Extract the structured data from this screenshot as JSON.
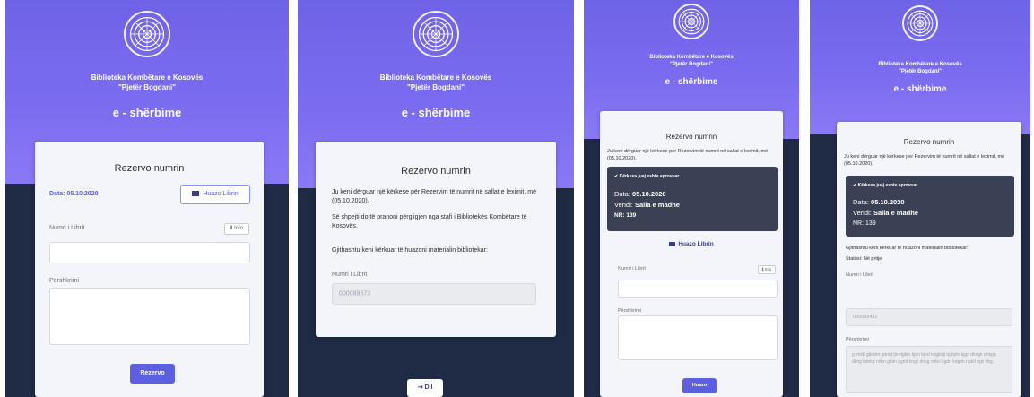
{
  "org": {
    "line1": "Biblioteka Kombëtare e Kosovës",
    "line2": "\"Pjetër Bogdani\"",
    "service": "e - shërbime"
  },
  "screens": [
    {
      "title": "Rezervo numrin",
      "date_label": "Data: 05.10.2020",
      "borrow_button": "Huazo Librin",
      "book_number_label": "Numri i Librit",
      "info_button": "Info",
      "description_label": "Përshkrimi",
      "submit_button": "Rezervo"
    },
    {
      "title": "Rezervo numrin",
      "message_1": "Ju keni dërguar një kërkese për Rezervim të numrit në sallat e leximit, më (05.10.2020).",
      "message_2": "Së shpejti do të pranoni përgjigjen nga stafi i Bibliotekës Kombëtare të Kosovës.",
      "message_3": "Gjithashtu keni kërkuar të huazoni materialin bibliotekar:",
      "book_number_label": "Numri i Librit",
      "book_number_value": "000089573",
      "exit_button": "Dil"
    },
    {
      "title": "Rezervo numrin",
      "message_1": "Ju keni dërguar një kërkese per Rezervim të numrit në sallat e leximit, më (05.10.2020).",
      "alert_heading": "Kërkesa juaj eshte aprovuar.",
      "alert_date_label": "Data:",
      "alert_date_value": "05.10.2020",
      "alert_place_label": "Vendi:",
      "alert_place_value": "Salla e madhe",
      "alert_nr": "NR: 139",
      "borrow_button": "Huazo Librin",
      "book_number_label": "Numri i Librit",
      "info_button": "Info",
      "description_label": "Përshkrimi",
      "submit_button": "Huazo"
    },
    {
      "title": "Rezervo numrin",
      "message_1": "Ju keni dërguar një kërkese per Rezervim të numrit në sallat e leximit, më (05.10.2020).",
      "alert_heading": "Kërkesa juaj eshte aprovuar.",
      "alert_date_label": "Data:",
      "alert_date_value": "05.10.2020",
      "alert_place_label": "Vendi:",
      "alert_place_value": "Salla e madhe",
      "alert_nr": "NR: 139",
      "message_2": "Gjithashtu keni kërkuar të huazoni materialin bibliotekar:",
      "status_text": "Statusi: Në pritje",
      "book_number_label": "Numri i Librit",
      "book_number_value": "000089432",
      "description_label": "Përshkrimi",
      "description_value": "g jmidl gbndm gdmd jbndgbjn kjdn bjnd knjgbdj ngbjdn kjgn dkngk dnkgn dkng kdnkg ndkn gkdn kgnd kngk dnkg ndkn kgdn kdgnk ngkd ngk dkg"
    }
  ],
  "colors": {
    "primary": "#5b5fe0",
    "header_gradient": "#6e63e6",
    "dark_bg": "#1f2a44",
    "alert_bg": "#3a4154"
  }
}
